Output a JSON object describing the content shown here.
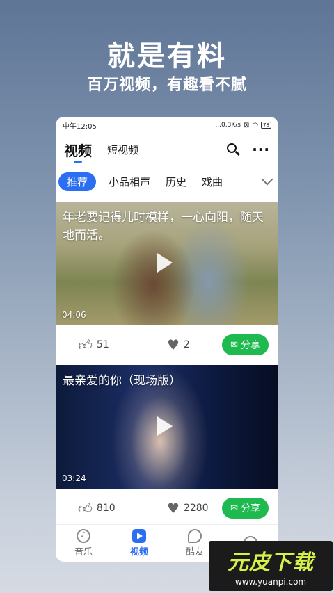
{
  "promo": {
    "title": "就是有料",
    "subtitle": "百万视频，有趣看不腻"
  },
  "status": {
    "time": "中午12:05",
    "speed": "...0.3K/s",
    "battery": "78"
  },
  "header": {
    "tab_main": "视频",
    "tab_short": "短视频",
    "more": "···"
  },
  "categories": [
    "推荐",
    "小品相声",
    "历史",
    "戏曲"
  ],
  "videos": [
    {
      "title": "年老要记得儿时模样，一心向阳，随天地而活。",
      "duration": "04:06",
      "likes": "51",
      "favs": "2",
      "share": "分享"
    },
    {
      "title": "最亲爱的你（现场版）",
      "duration": "03:24",
      "likes": "810",
      "favs": "2280",
      "share": "分享"
    }
  ],
  "tabbar": [
    {
      "label": "音乐"
    },
    {
      "label": "视频"
    },
    {
      "label": "酷友"
    },
    {
      "label": ""
    }
  ],
  "watermark": {
    "logo": "元皮下载",
    "url": "www.yuanpi.com"
  },
  "colors": {
    "accent": "#2b6ef2",
    "share_green": "#1fba4f"
  }
}
